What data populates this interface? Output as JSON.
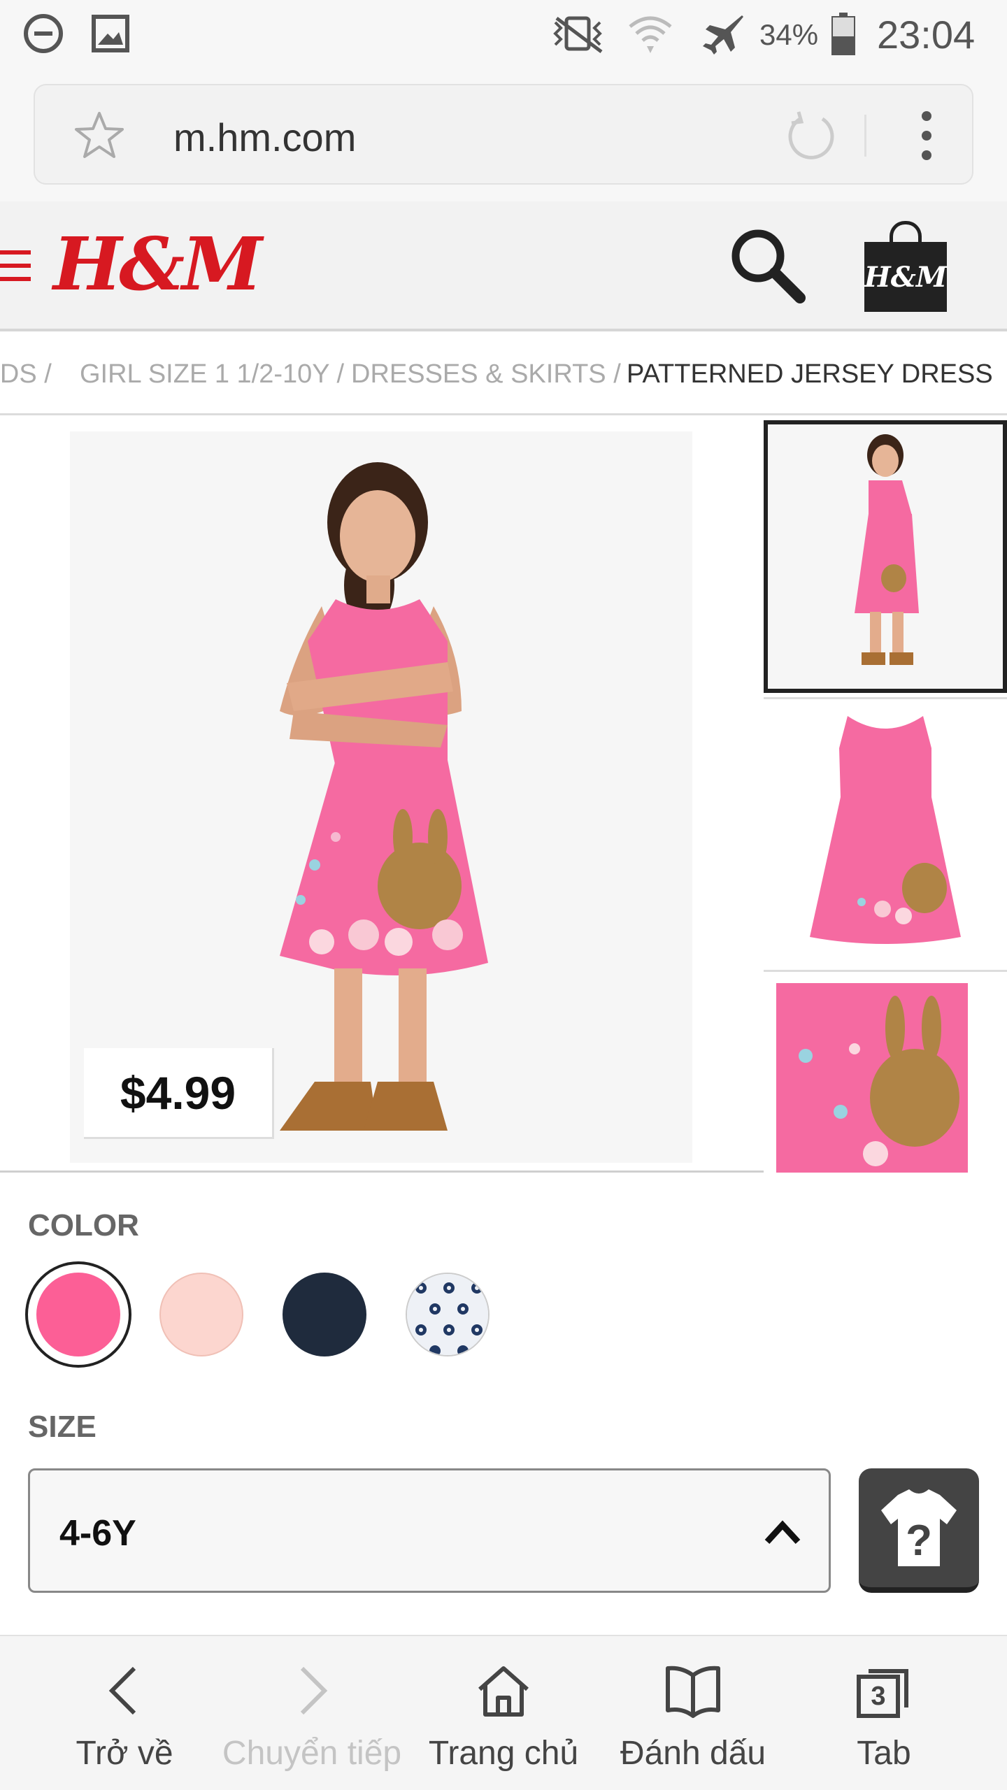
{
  "status_bar": {
    "battery": "34%",
    "time": "23:04"
  },
  "browser": {
    "url": "m.hm.com"
  },
  "header": {
    "logo": "H&M",
    "bag_logo": "H&M"
  },
  "breadcrumb": {
    "items": [
      "KIDS /",
      "GIRL SIZE 1 1/2-10Y /",
      "DRESSES & SKIRTS /",
      "PATTERNED JERSEY DRESS"
    ]
  },
  "product": {
    "price": "$4.99",
    "color_label": "COLOR",
    "colors": [
      "#fc5f96",
      "#fcd6cf",
      "#1f2b3d",
      "pattern-blue-white"
    ],
    "selected_color_index": 0,
    "size_label": "SIZE",
    "size_value": "4-6Y"
  },
  "bottom_bar": {
    "back": "Trở về",
    "forward": "Chuyển tiếp",
    "home": "Trang chủ",
    "bookmarks": "Đánh dấu",
    "tabs": "Tab",
    "tab_count": "3"
  }
}
